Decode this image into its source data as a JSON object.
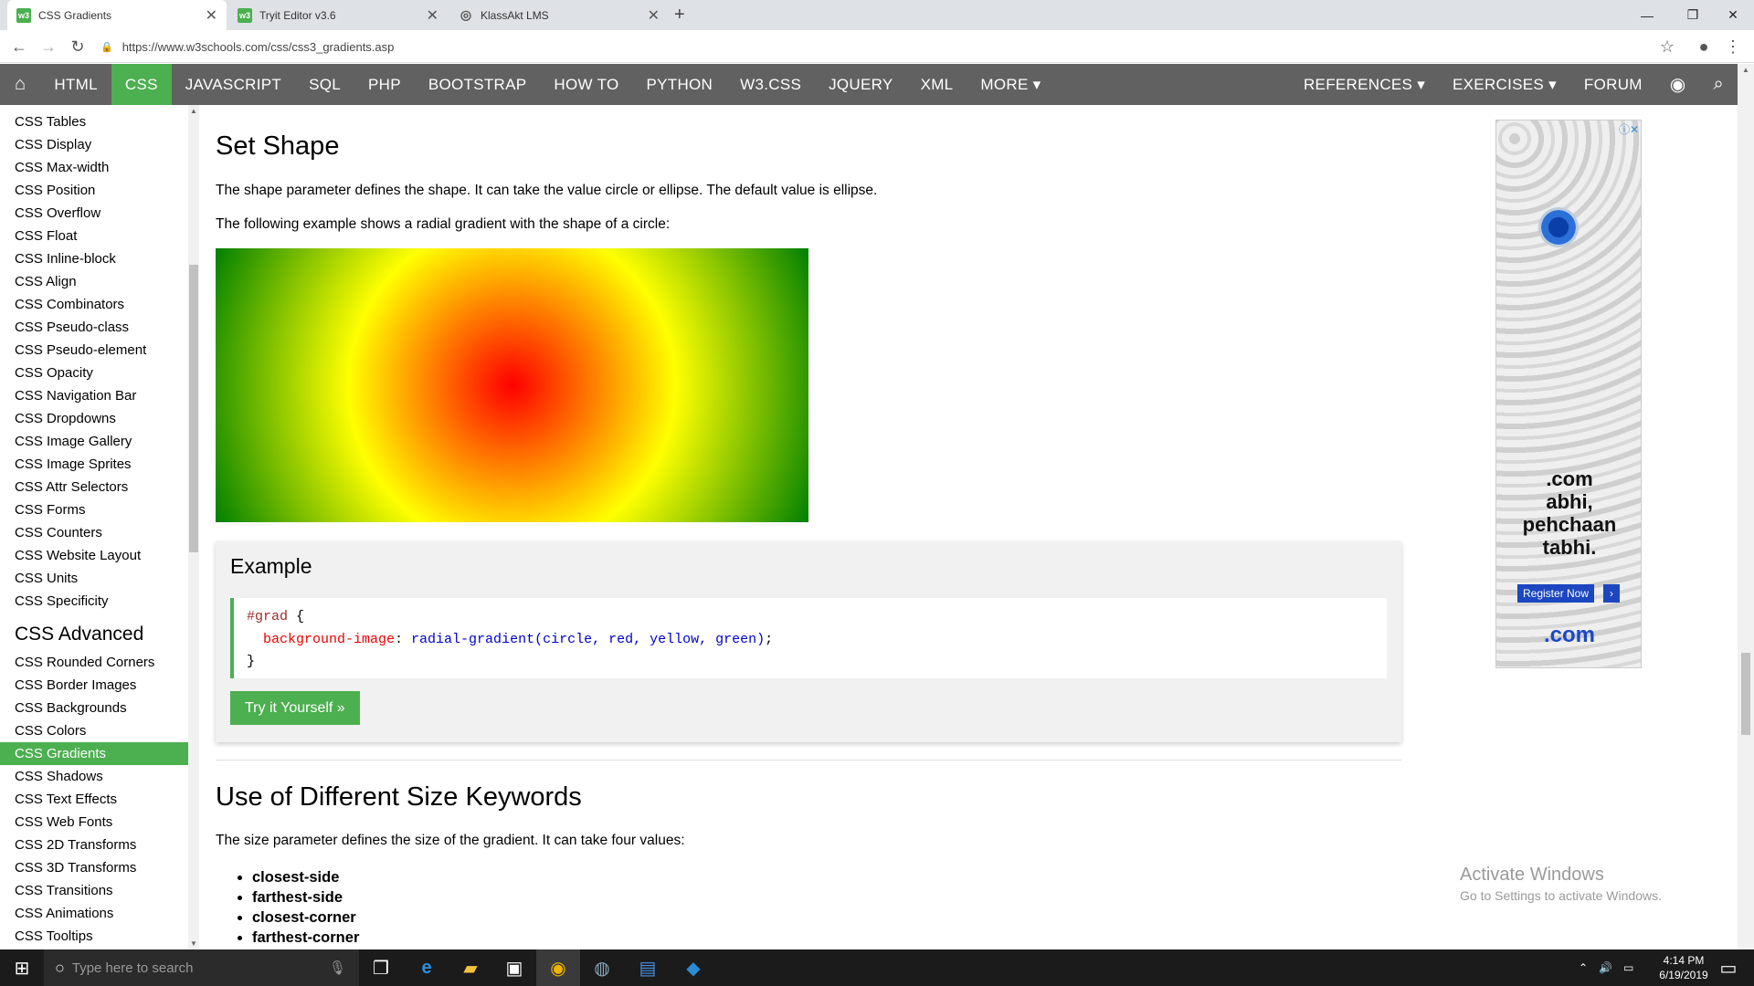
{
  "browser": {
    "tabs": [
      {
        "title": "CSS Gradients",
        "active": true
      },
      {
        "title": "Tryit Editor v3.6",
        "active": false
      },
      {
        "title": "KlassAkt LMS",
        "active": false
      }
    ],
    "url": "https://www.w3schools.com/css/css3_gradients.asp"
  },
  "topnav": {
    "items": [
      "HTML",
      "CSS",
      "JAVASCRIPT",
      "SQL",
      "PHP",
      "BOOTSTRAP",
      "HOW TO",
      "PYTHON",
      "W3.CSS",
      "JQUERY",
      "XML",
      "MORE ▾"
    ],
    "right": [
      "REFERENCES ▾",
      "EXERCISES ▾",
      "FORUM"
    ]
  },
  "sidebar": {
    "links_top": [
      "CSS Tables",
      "CSS Display",
      "CSS Max-width",
      "CSS Position",
      "CSS Overflow",
      "CSS Float",
      "CSS Inline-block",
      "CSS Align",
      "CSS Combinators",
      "CSS Pseudo-class",
      "CSS Pseudo-element",
      "CSS Opacity",
      "CSS Navigation Bar",
      "CSS Dropdowns",
      "CSS Image Gallery",
      "CSS Image Sprites",
      "CSS Attr Selectors",
      "CSS Forms",
      "CSS Counters",
      "CSS Website Layout",
      "CSS Units",
      "CSS Specificity"
    ],
    "advanced_heading": "CSS Advanced",
    "links_advanced": [
      "CSS Rounded Corners",
      "CSS Border Images",
      "CSS Backgrounds",
      "CSS Colors",
      "CSS Gradients",
      "CSS Shadows",
      "CSS Text Effects",
      "CSS Web Fonts",
      "CSS 2D Transforms",
      "CSS 3D Transforms",
      "CSS Transitions",
      "CSS Animations",
      "CSS Tooltips"
    ],
    "active": "CSS Gradients"
  },
  "main": {
    "section1_title": "Set Shape",
    "section1_p1": "The shape parameter defines the shape. It can take the value circle or ellipse. The default value is ellipse.",
    "section1_p2": "The following example shows a radial gradient with the shape of a circle:",
    "example_title": "Example",
    "code_selector": "#grad",
    "code_open": " {",
    "code_property": "background-image",
    "code_colon": ": ",
    "code_value": "radial-gradient(circle, red, yellow, green)",
    "code_semicolon": ";",
    "code_close": "}",
    "tryit_label": "Try it Yourself »",
    "section2_title": "Use of Different Size Keywords",
    "section2_p1": "The size parameter defines the size of the gradient. It can take four values:",
    "size_keywords": [
      "closest-side",
      "farthest-side",
      "closest-corner",
      "farthest-corner"
    ]
  },
  "ad": {
    "brand": "com",
    "tagline_line1": ".com",
    "tagline_line2": "abhi,",
    "tagline_line3": "pehchaan",
    "tagline_line4": "tabhi.",
    "button": "Register Now",
    "logo": ".com"
  },
  "watermark": {
    "title": "Activate Windows",
    "subtitle": "Go to Settings to activate Windows."
  },
  "taskbar": {
    "search_placeholder": "Type here to search",
    "time": "4:14 PM",
    "date": "6/19/2019"
  },
  "colors": {
    "accent": "#4CAF50",
    "nav_bg": "#616161",
    "link_blue": "#1a47c9"
  }
}
